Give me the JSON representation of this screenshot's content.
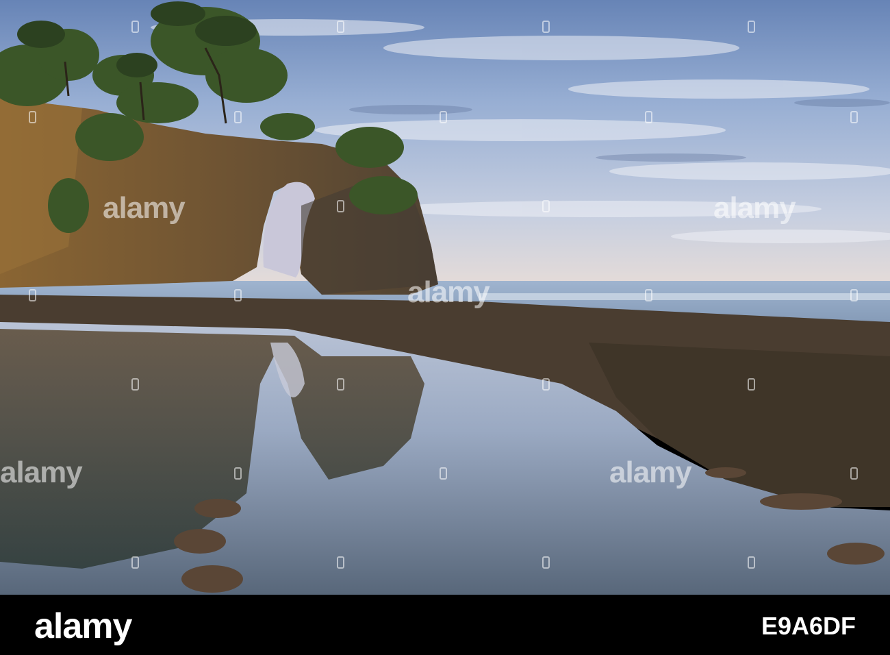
{
  "scene": {
    "description_icon": "rock-arch-seascape-photo",
    "colors": {
      "sky_top": "#6f8fbf",
      "sky_mid": "#a9bede",
      "sky_horizon": "#e2d9d8",
      "sea": "#8fa8c4",
      "cliff": "#7a5a32",
      "foliage": "#3e5a2a",
      "reef": "#4a3c30"
    }
  },
  "watermark": {
    "text": "alamy"
  },
  "footer": {
    "brand": "alamy",
    "image_id": "E9A6DF"
  }
}
